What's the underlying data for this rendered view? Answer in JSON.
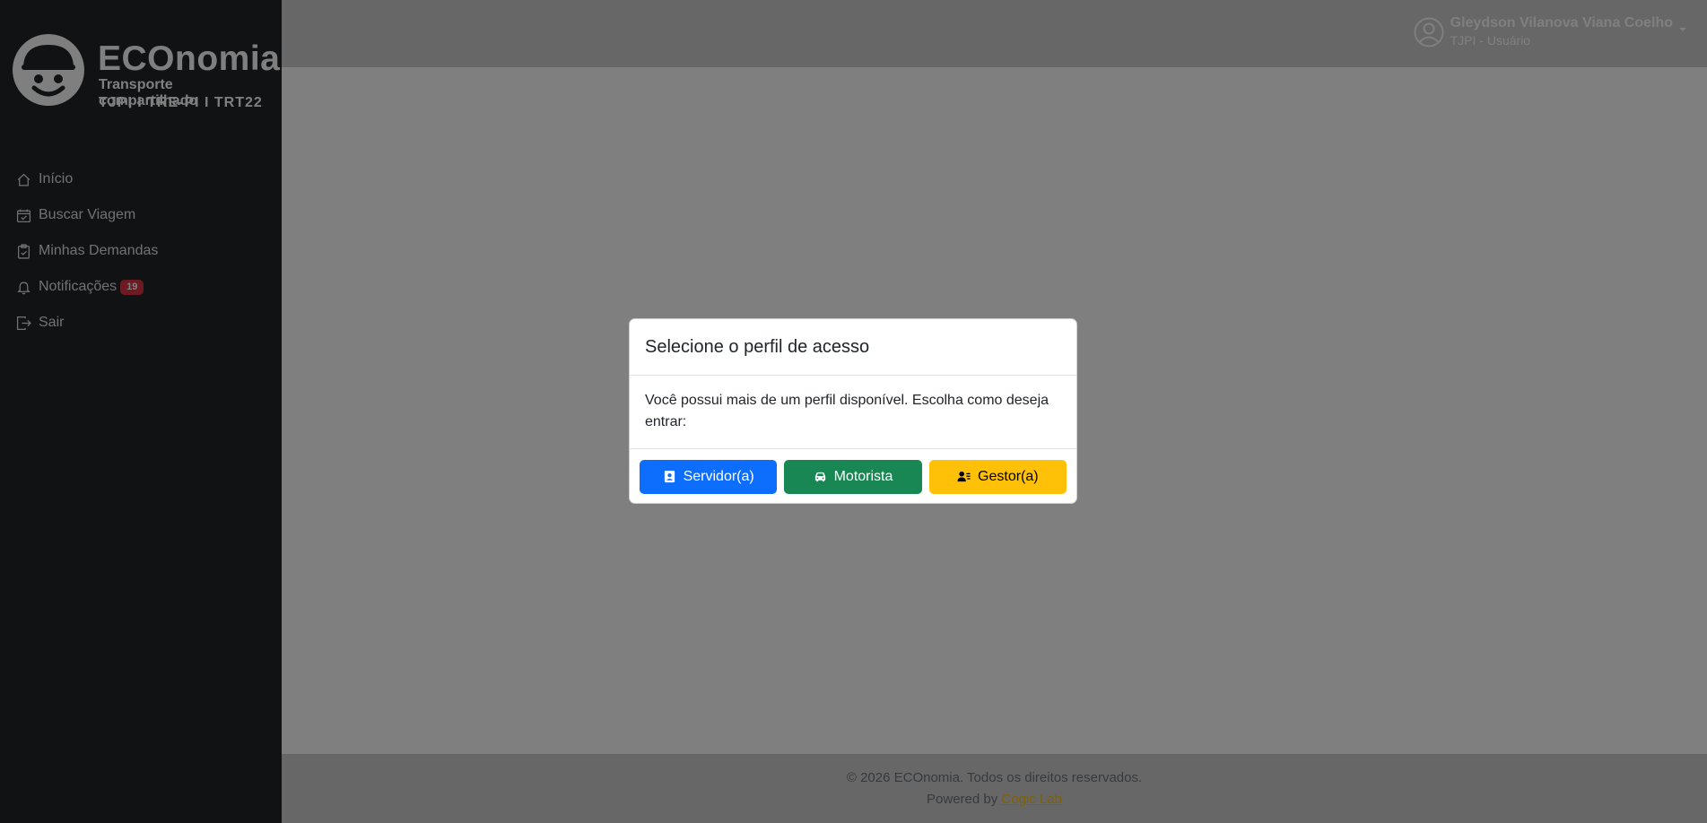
{
  "brand": {
    "name": "ECOnomia",
    "tagline": "Transporte compartilhado",
    "orgs": "TJPI I TRE-PI I TRT22"
  },
  "nav": {
    "items": [
      {
        "label": "Início",
        "icon": "home-icon"
      },
      {
        "label": "Buscar Viagem",
        "icon": "calendar-check-icon"
      },
      {
        "label": "Minhas Demandas",
        "icon": "clipboard-check-icon"
      },
      {
        "label": "Notificações",
        "icon": "bell-icon",
        "badge": "19"
      },
      {
        "label": "Sair",
        "icon": "logout-icon"
      }
    ]
  },
  "user": {
    "name": "Gleydson Vilanova Viana Coelho",
    "role": "TJPI - Usuário"
  },
  "footer": {
    "copyright": "© 2026 ECOnomia. Todos os direitos reservados.",
    "powered_prefix": "Powered by",
    "powered_link": "Cogic Lab"
  },
  "modal": {
    "title": "Selecione o perfil de acesso",
    "message": "Você possui mais de um perfil disponível. Escolha como deseja entrar:",
    "buttons": {
      "servidor": "Servidor(a)",
      "motorista": "Motorista",
      "gestor": "Gestor(a)"
    }
  },
  "colors": {
    "sidebar": "#212529",
    "primary": "#0d6efd",
    "success": "#198754",
    "warning": "#ffc107",
    "danger": "#dc3545"
  }
}
